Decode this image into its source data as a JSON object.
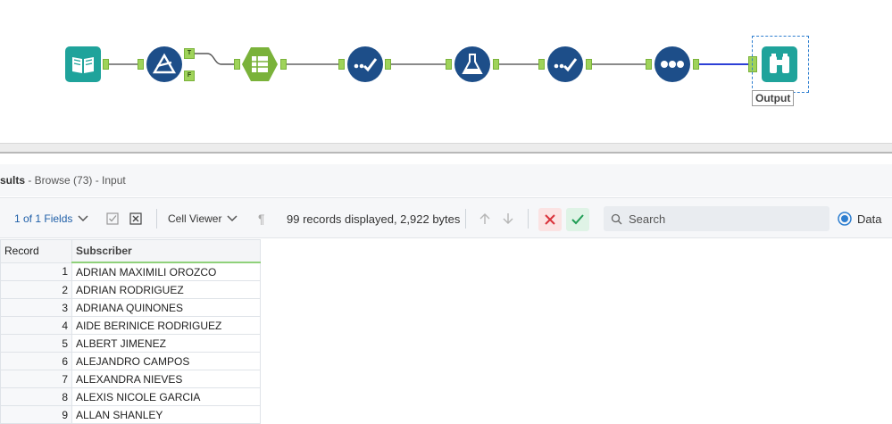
{
  "workflow": {
    "output_label": "Output",
    "filter_anchor_true": "T",
    "filter_anchor_false": "F"
  },
  "results": {
    "title_prefix": "sults",
    "title_rest": " - Browse (73) - Input"
  },
  "toolbar": {
    "fields_label": "1 of 1 Fields",
    "cell_viewer_label": "Cell Viewer",
    "records_info": "99 records displayed, 2,922 bytes",
    "search_placeholder": "Search",
    "data_radio_label": "Data"
  },
  "grid": {
    "columns": [
      "Record",
      "Subscriber"
    ],
    "rows": [
      {
        "record": "1",
        "subscriber": "ADRIAN MAXIMILI OROZCO"
      },
      {
        "record": "2",
        "subscriber": "ADRIAN RODRIGUEZ"
      },
      {
        "record": "3",
        "subscriber": "ADRIANA QUINONES"
      },
      {
        "record": "4",
        "subscriber": "AIDE BERINICE RODRIGUEZ"
      },
      {
        "record": "5",
        "subscriber": "ALBERT JIMENEZ"
      },
      {
        "record": "6",
        "subscriber": "ALEJANDRO CAMPOS"
      },
      {
        "record": "7",
        "subscriber": "ALEXANDRA NIEVES"
      },
      {
        "record": "8",
        "subscriber": "ALEXIS NICOLE GARCIA"
      },
      {
        "record": "9",
        "subscriber": "ALLAN SHANLEY"
      }
    ]
  },
  "colors": {
    "tool_blue": "#1d4e89",
    "input_teal": "#1fa39b",
    "formula_green": "#7ab23a",
    "anchor_green": "#9fd35a",
    "selection_blue": "#2f7fd0"
  }
}
